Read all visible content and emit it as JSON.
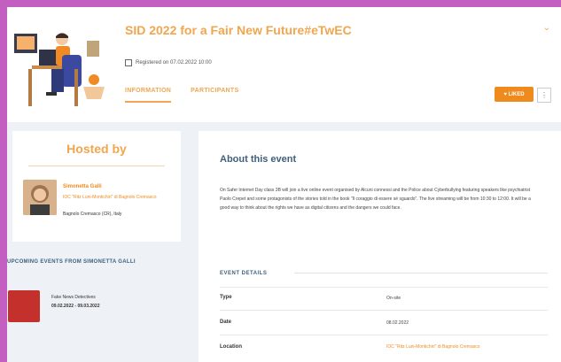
{
  "event": {
    "title": "SID 2022 for a Fair New Future#eTwEC",
    "registered": "Registered on 07.02.2022 10:00"
  },
  "tabs": [
    {
      "label": "INFORMATION",
      "active": true
    },
    {
      "label": "PARTICIPANTS",
      "active": false
    }
  ],
  "actions": {
    "like_label": "♥ LIKED",
    "more_label": "⋮"
  },
  "hosted": {
    "title": "Hosted by",
    "name": "Simonetta Galli",
    "org": "IOC \"Ritz Luni-Montichiri\" di Bagnolo Cremasco",
    "location": "Bagnolo Cremasco (CR), Italy"
  },
  "upcoming": {
    "title": "UPCOMING EVENTS FROM SIMONETTA GALLI",
    "items": [
      {
        "name": "Fake News Detectives",
        "date": "09.02.2022 - 09.03.2022"
      }
    ]
  },
  "about": {
    "title": "About this event",
    "text": "On Safer Internet Day class 3B will join a live online event organised by Alcuni connessi and the Police about Cyberbullying featuring speakers like psychiatrist Paolo Crepet and some protagonists of the stories told in the book \"Il coraggio di essere sé sguardo\". The live streaming will be from 10:30 to 12:00. It will be a good way to think about the rights we have as digital citizens and the dangers we could face."
  },
  "details": {
    "title": "EVENT DETAILS",
    "rows": [
      {
        "label": "Type",
        "value": "On-site"
      },
      {
        "label": "Date",
        "value": "08.02.2022"
      },
      {
        "label": "Location",
        "value": "IOC \"Ritz Luni-Montichiri\" di Bagnolo Cremasco"
      }
    ]
  },
  "colors": {
    "accent": "#ef8a1d",
    "heading": "#3e5f7c",
    "frame": "#c25fc0"
  }
}
